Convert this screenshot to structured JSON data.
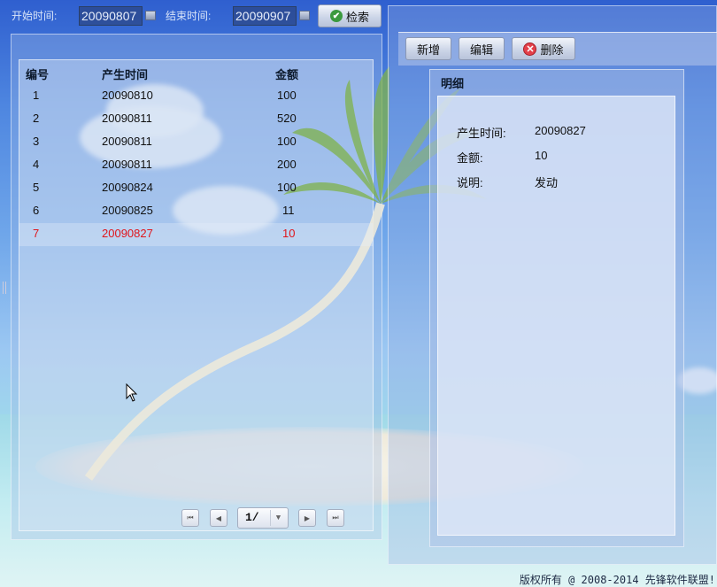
{
  "search": {
    "start_label": "开始时间:",
    "start_value": "20090807",
    "end_label": "结束时间:",
    "end_value": "20090907",
    "search_button": "检索"
  },
  "grid": {
    "columns": [
      "编号",
      "产生时间",
      "金额"
    ],
    "rows": [
      {
        "id": "1",
        "time": "20090810",
        "amount": "100"
      },
      {
        "id": "2",
        "time": "20090811",
        "amount": "520"
      },
      {
        "id": "3",
        "time": "20090811",
        "amount": "100"
      },
      {
        "id": "4",
        "time": "20090811",
        "amount": "200"
      },
      {
        "id": "5",
        "time": "20090824",
        "amount": "100"
      },
      {
        "id": "6",
        "time": "20090825",
        "amount": "11"
      },
      {
        "id": "7",
        "time": "20090827",
        "amount": "10"
      }
    ],
    "selected_row": "7"
  },
  "pager": {
    "page_text": "1/"
  },
  "toolbar": {
    "add_label": "新增",
    "edit_label": "编辑",
    "delete_label": "删除"
  },
  "detail": {
    "title": "明细",
    "time_label": "产生时间:",
    "time_value": "20090827",
    "amount_label": "金额:",
    "amount_value": "10",
    "note_label": "说明:",
    "note_value": "发动"
  },
  "footer": {
    "copyright": "版权所有 @ 2008-2014 先锋软件联盟!"
  },
  "colors": {
    "selected_row": "#e0151b",
    "search_icon": "#3b9a3f",
    "delete_icon": "#e3404a"
  }
}
